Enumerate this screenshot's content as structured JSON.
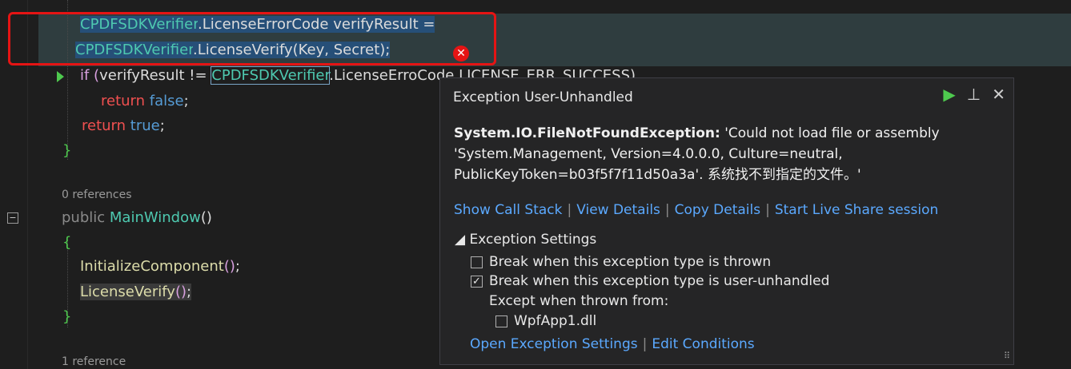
{
  "code": {
    "line1": [
      "CPDFSDKVerifier",
      ".LicenseErrorCode verifyResult ="
    ],
    "line2": [
      "CPDFSDKVerifier",
      ".LicenseVerify(Key, Secret);"
    ],
    "line3": [
      "if (",
      "verifyResult != ",
      "CPDFSDKVerifier",
      ".LicenseErro",
      "Code.LICENSE_ERR_SUCCESS)"
    ],
    "line4": [
      "return ",
      "false",
      ";"
    ],
    "line5": [
      "return ",
      "true",
      ";"
    ],
    "close_brace": "}",
    "refs0": "0 references",
    "ctor": [
      "public ",
      "MainWindow",
      "()"
    ],
    "open_brace": "{",
    "init": [
      "InitializeComponent",
      "()",
      ";"
    ],
    "verify": [
      "LicenseVerify",
      "()",
      ";"
    ],
    "close_brace2": "}",
    "refs1": "1 reference"
  },
  "error_marker": "✕",
  "fold_marker": "−",
  "popup": {
    "title": "Exception User-Unhandled",
    "actions": {
      "play": "▶",
      "pin": "⊥",
      "close": "✕"
    },
    "exception_type": "System.IO.FileNotFoundException:",
    "message": " 'Could not load file or assembly 'System.Management, Version=4.0.0.0, Culture=neutral, PublicKeyToken=b03f5f7f11d50a3a'. 系统找不到指定的文件。'",
    "links": [
      "Show Call Stack",
      "View Details",
      "Copy Details",
      "Start Live Share session"
    ],
    "separator": "|",
    "settings_header": "◢ Exception Settings",
    "options": [
      {
        "label": "Break when this exception type is thrown",
        "checked": false
      },
      {
        "label": "Break when this exception type is user-unhandled",
        "checked": true
      }
    ],
    "except_label": "Except when thrown from:",
    "module": {
      "label": "WpfApp1.dll",
      "checked": false
    },
    "bottom_links": [
      "Open Exception Settings",
      "Edit Conditions"
    ],
    "check_mark": "✓"
  }
}
